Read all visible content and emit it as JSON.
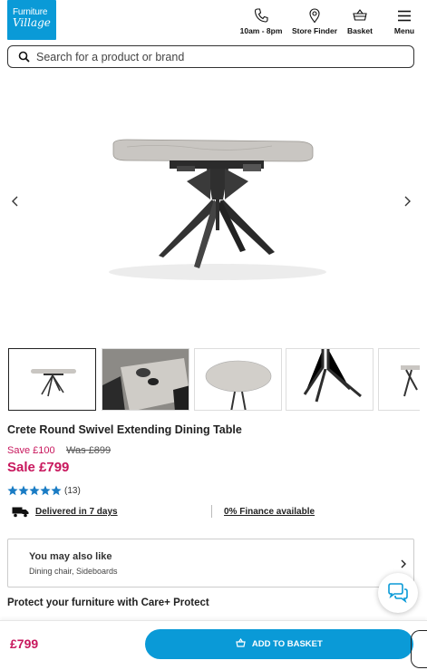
{
  "header": {
    "logo_line1": "Furniture",
    "logo_line2": "Village",
    "phone_label": "10am - 8pm",
    "store_label": "Store Finder",
    "basket_label": "Basket",
    "menu_label": "Menu"
  },
  "search": {
    "placeholder": "Search for a product or brand",
    "value": ""
  },
  "product": {
    "title": "Crete Round Swivel Extending Dining Table",
    "save_text": "Save £100",
    "was_text": "Was £899",
    "sale_text": "Sale £799",
    "rating_stars": 5,
    "rating_count": "(13)",
    "delivery_text": "Delivered in 7 days",
    "finance_text": "0% Finance available"
  },
  "gallery": {
    "thumbnail_count": 5,
    "active_index": 0
  },
  "also_like": {
    "title": "You may also like",
    "subtitle": "Dining chair, Sideboards"
  },
  "protect": {
    "title": "Protect your furniture with Care+ Protect"
  },
  "bottom_bar": {
    "price": "£799",
    "button_label": "ADD TO BASKET"
  },
  "colors": {
    "brand_blue": "#0a9ad7",
    "sale_pink": "#c8175d",
    "star_blue": "#1a7cc4"
  }
}
